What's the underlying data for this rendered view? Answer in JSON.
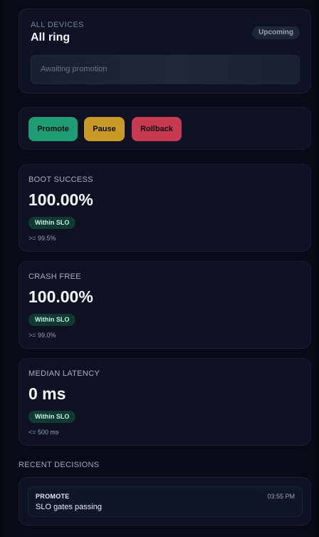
{
  "device": {
    "eyebrow": "ALL DEVICES",
    "title": "All ring",
    "status": "Upcoming",
    "promotion_status": "Awaiting promotion"
  },
  "actions": {
    "promote_label": "Promote",
    "pause_label": "Pause",
    "rollback_label": "Rollback"
  },
  "metrics": [
    {
      "label": "BOOT SUCCESS",
      "value": "100.00%",
      "badge": "Within SLO",
      "threshold": ">= 99.5%"
    },
    {
      "label": "CRASH FREE",
      "value": "100.00%",
      "badge": "Within SLO",
      "threshold": ">= 99.0%"
    },
    {
      "label": "MEDIAN LATENCY",
      "value": "0 ms",
      "badge": "Within SLO",
      "threshold": "<= 500 ms"
    }
  ],
  "recent_decisions": {
    "title": "RECENT DECISIONS",
    "items": [
      {
        "action": "PROMOTE",
        "time": "03:55 PM",
        "text": "SLO gates passing"
      }
    ]
  },
  "colors": {
    "promote": "#1f9c74",
    "pause": "#c99a26",
    "rollback": "#c83a52",
    "slo_badge_bg": "#113b32"
  }
}
